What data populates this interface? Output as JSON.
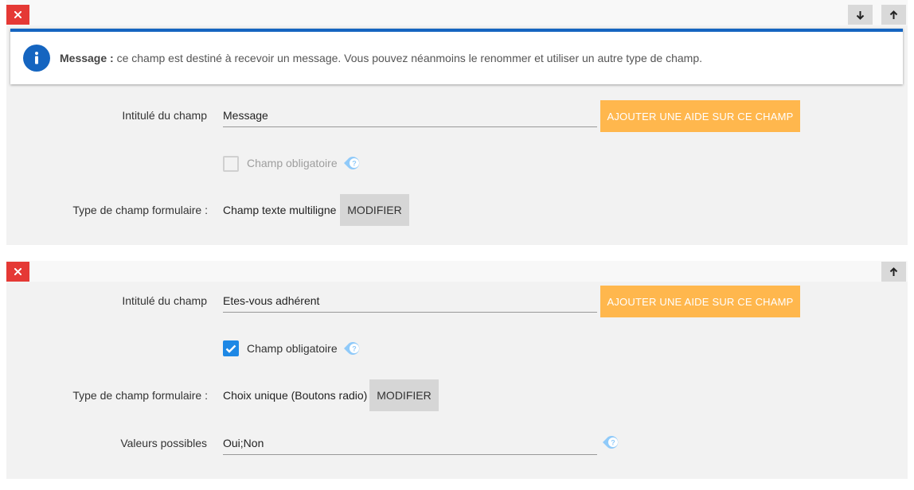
{
  "colors": {
    "danger": "#e53935",
    "accent_orange": "#ffb74d",
    "primary_blue": "#1565c0",
    "check_blue": "#1e88e5",
    "help_icon": "#90caf9"
  },
  "field1": {
    "info": {
      "title": "Message :",
      "text": "ce champ est destiné à recevoir un message. Vous pouvez néanmoins le renommer et utiliser un autre type de champ."
    },
    "label_title": "Intitulé du champ",
    "title_value": "Message",
    "help_button": "AJOUTER UNE AIDE SUR CE CHAMP",
    "required_label": "Champ obligatoire",
    "required_checked": false,
    "type_label": "Type de champ formulaire :",
    "type_value": "Champ texte multiligne",
    "modify_button": "MODIFIER"
  },
  "field2": {
    "label_title": "Intitulé du champ",
    "title_value": "Etes-vous adhérent",
    "help_button": "AJOUTER UNE AIDE SUR CE CHAMP",
    "required_label": "Champ obligatoire",
    "required_checked": true,
    "type_label": "Type de champ formulaire :",
    "type_value": "Choix unique (Boutons radio)",
    "modify_button": "MODIFIER",
    "values_label": "Valeurs possibles",
    "values_value": "Oui;Non"
  }
}
